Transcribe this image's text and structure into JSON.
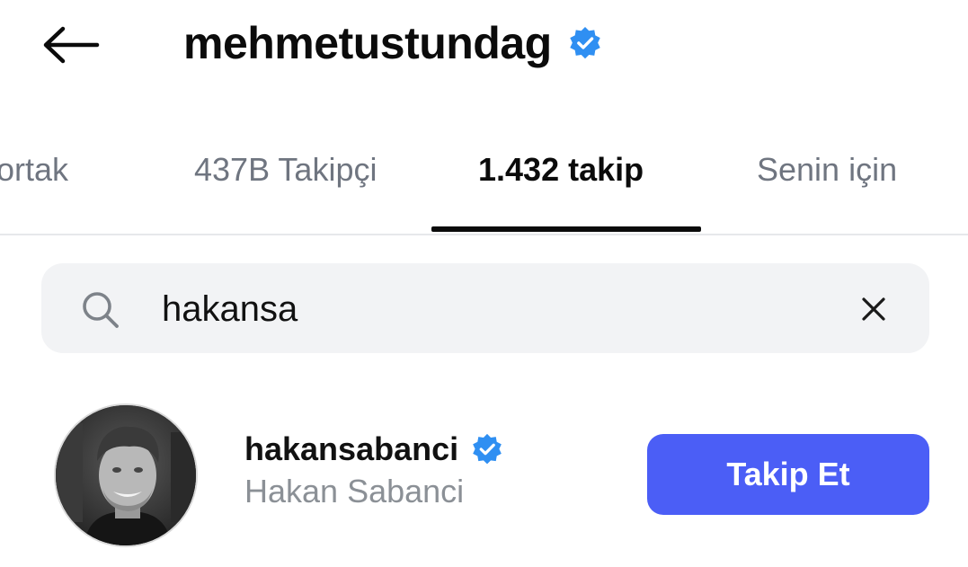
{
  "header": {
    "back_icon": "arrow-left-icon",
    "username": "mehmetustundag",
    "verified_icon": "verified-badge-icon"
  },
  "tabs": [
    {
      "label": "ortak",
      "active": false
    },
    {
      "label": "437B Takipçi",
      "active": false
    },
    {
      "label": "1.432 takip",
      "active": true
    },
    {
      "label": "Senin için",
      "active": false
    }
  ],
  "search": {
    "icon": "search-icon",
    "value": "hakansa",
    "clear_icon": "close-icon"
  },
  "results": [
    {
      "username": "hakansabanci",
      "full_name": "Hakan Sabanci",
      "verified": true,
      "button_label": "Takip Et"
    }
  ],
  "colors": {
    "verified_blue": "#2f8ff2",
    "follow_button": "#4b5ef6",
    "inactive_tab": "#6f7580",
    "search_bg": "#f2f3f5",
    "secondary_text": "#8b9096"
  }
}
